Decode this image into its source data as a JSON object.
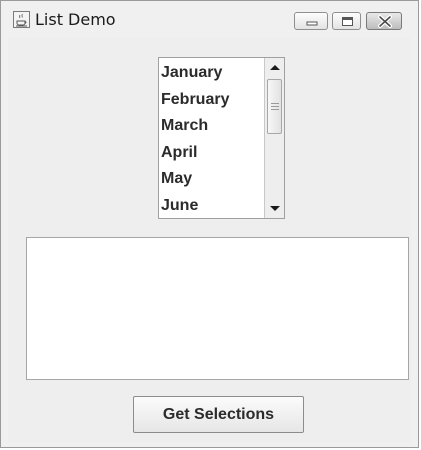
{
  "window": {
    "title": "List Demo",
    "icon": "java-cup-icon",
    "controls": [
      "minimize-icon",
      "maximize-icon",
      "close-icon"
    ]
  },
  "month_list": {
    "items": [
      "January",
      "February",
      "March",
      "April",
      "May",
      "June"
    ]
  },
  "selections_text_area": {
    "value": ""
  },
  "get_button": {
    "label": "Get Selections"
  }
}
